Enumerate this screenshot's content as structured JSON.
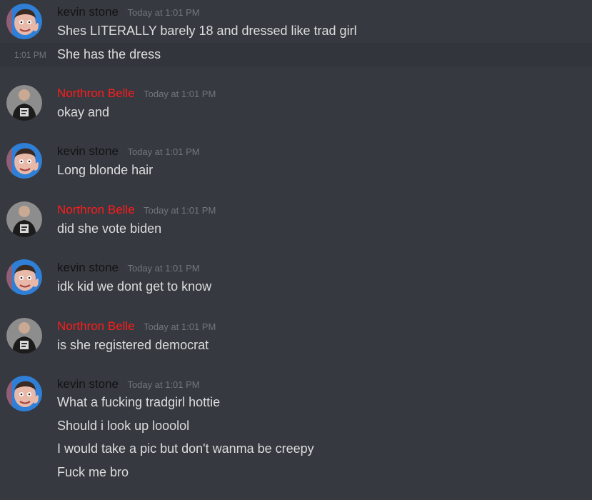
{
  "messages": [
    {
      "author": "kevin stone",
      "timestamp": "Today at 1:01 PM",
      "lines": [
        "Shes LITERALLY barely 18 and dressed like trad girl",
        "She has the dress"
      ],
      "hover_time": "1:01 PM"
    },
    {
      "author": "Northron Belle",
      "timestamp": "Today at 1:01 PM",
      "lines": [
        "okay and"
      ]
    },
    {
      "author": "kevin stone",
      "timestamp": "Today at 1:01 PM",
      "lines": [
        "Long blonde hair"
      ]
    },
    {
      "author": "Northron Belle",
      "timestamp": "Today at 1:01 PM",
      "lines": [
        "did she vote biden"
      ]
    },
    {
      "author": "kevin stone",
      "timestamp": "Today at 1:01 PM",
      "lines": [
        "idk kid we dont get to know"
      ]
    },
    {
      "author": "Northron Belle",
      "timestamp": "Today at 1:01 PM",
      "lines": [
        "is she registered democrat"
      ]
    },
    {
      "author": "kevin stone",
      "timestamp": "Today at 1:01 PM",
      "lines": [
        "What a fucking tradgirl hottie",
        "Should i look up looolol",
        "I would take a pic but don't wanma be creepy",
        "Fuck me bro"
      ]
    }
  ],
  "colors": {
    "background": "#36393f",
    "hover_background": "#32353b",
    "message_text": "#dcddde",
    "timestamp": "#72767d",
    "kevin_name": "#111214",
    "northron_name": "#ff1c1c"
  },
  "icons": {
    "kevin_avatar": "avatar-cartoon-face-icon",
    "northron_avatar": "avatar-person-tshirt-icon"
  }
}
